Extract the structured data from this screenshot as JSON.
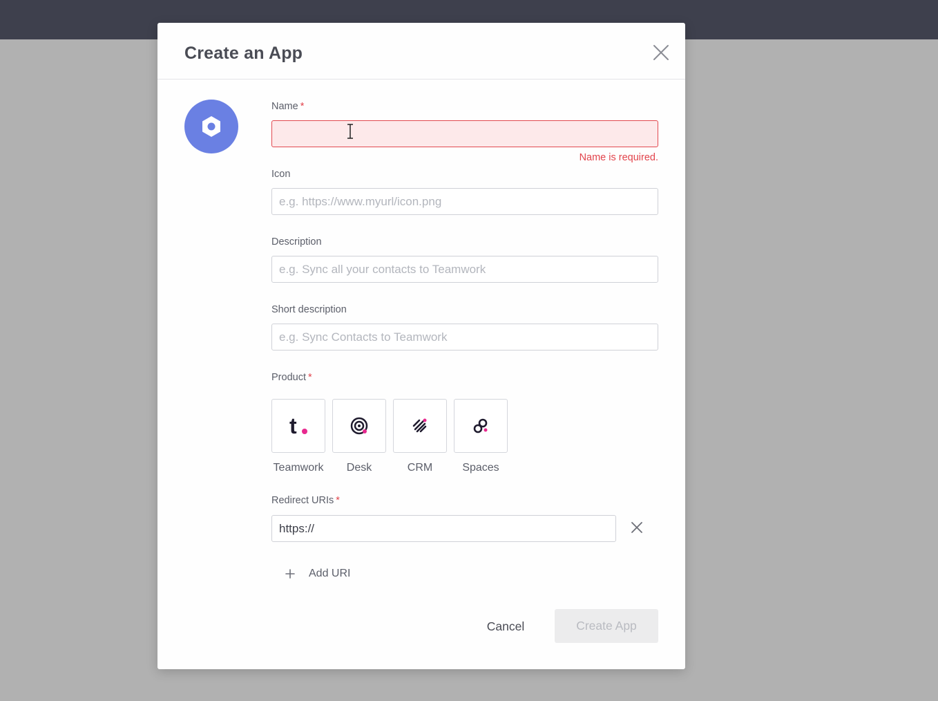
{
  "modal": {
    "title": "Create an App"
  },
  "form": {
    "name": {
      "label": "Name",
      "required": "*",
      "value": "",
      "placeholder": "",
      "error": "Name is required."
    },
    "icon": {
      "label": "Icon",
      "placeholder": "e.g. https://www.myurl/icon.png"
    },
    "description": {
      "label": "Description",
      "placeholder": "e.g. Sync all your contacts to Teamwork"
    },
    "short_description": {
      "label": "Short description",
      "placeholder": "e.g. Sync Contacts to Teamwork"
    },
    "product": {
      "label": "Product",
      "required": "*",
      "options": [
        {
          "label": "Teamwork",
          "icon": "teamwork-icon"
        },
        {
          "label": "Desk",
          "icon": "desk-icon"
        },
        {
          "label": "CRM",
          "icon": "crm-icon"
        },
        {
          "label": "Spaces",
          "icon": "spaces-icon"
        }
      ]
    },
    "redirect_uris": {
      "label": "Redirect URIs",
      "required": "*",
      "values": [
        "https://"
      ],
      "add_label": "Add URI"
    }
  },
  "actions": {
    "cancel_label": "Cancel",
    "create_label": "Create App"
  },
  "colors": {
    "topbar": "#3e404d",
    "overlay": "#b1b1b1",
    "avatar": "#6a80e3",
    "error": "#e2444c",
    "accent_dot": "#e8298f"
  }
}
